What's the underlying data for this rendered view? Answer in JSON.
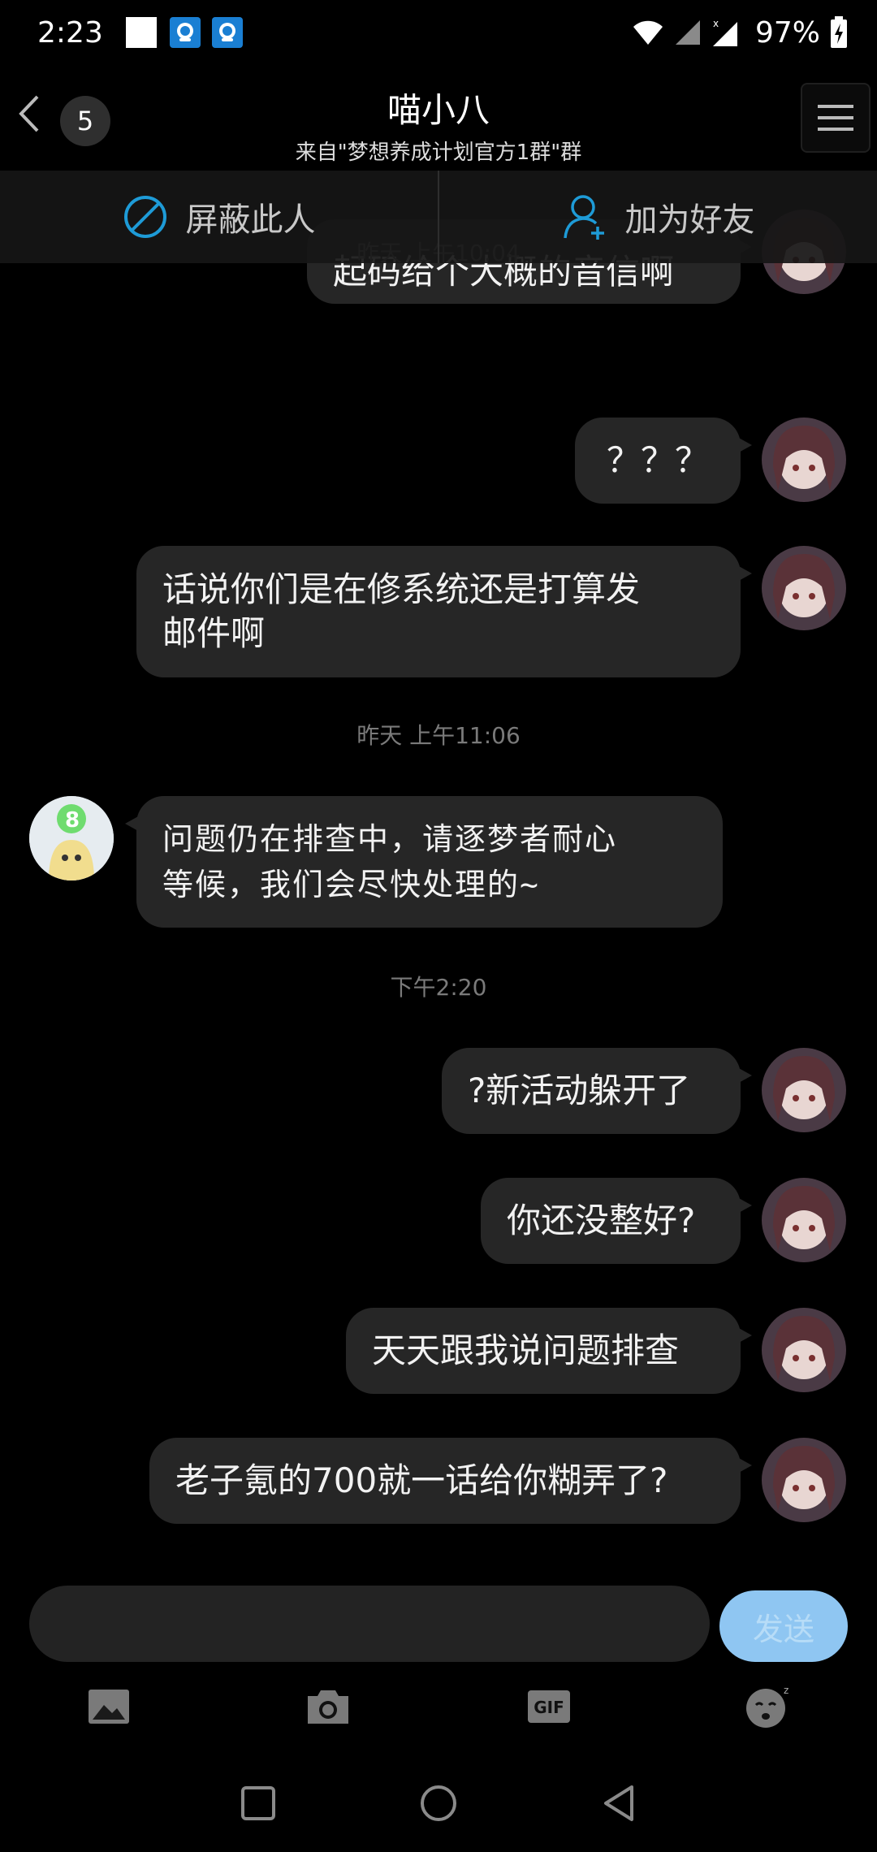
{
  "status_bar": {
    "time": "2:23",
    "battery": "97%",
    "icons": [
      "white-square-icon",
      "chat-app-icon",
      "chat-app-icon",
      "wifi-icon",
      "signal-icon",
      "signal-x-icon",
      "battery-charging-icon"
    ]
  },
  "header": {
    "back_icon": "chevron-left-icon",
    "unread_count": "5",
    "title": "喵小八",
    "subtitle": "来自\"梦想养成计划官方1群\"群",
    "menu_icon": "hamburger-menu-icon"
  },
  "actions": {
    "block_label": "屏蔽此人",
    "block_icon": "block-icon",
    "add_friend_label": "加为好友",
    "add_friend_icon": "add-person-icon"
  },
  "messages": {
    "partial_text": "起码给个大概的音信啊",
    "ts1": "昨天 上午10:04",
    "m1": "？？？",
    "m2_line1": "话说你们是在修系统还是打算发",
    "m2_line2": "邮件啊",
    "ts2": "昨天 上午11:06",
    "m3_line1": "问题仍在排查中，请逐梦者耐心",
    "m3_line2": "等候，我们会尽快处理的~",
    "ts3": "下午2:20",
    "m4": "?新活动躲开了",
    "m5": "你还没整好?",
    "m6": "天天跟我说问题排查",
    "m7": "老子氪的700就一话给你糊弄了?"
  },
  "input": {
    "placeholder": "",
    "send_label": "发送"
  },
  "toolbar": {
    "icons": [
      "image-icon",
      "camera-icon",
      "gif-icon",
      "emoji-icon"
    ],
    "gif_label": "GIF"
  },
  "colors": {
    "background": "#000000",
    "bubble": "#262626",
    "accent": "#1e9bd7",
    "send_button": "#8fc6f2"
  }
}
